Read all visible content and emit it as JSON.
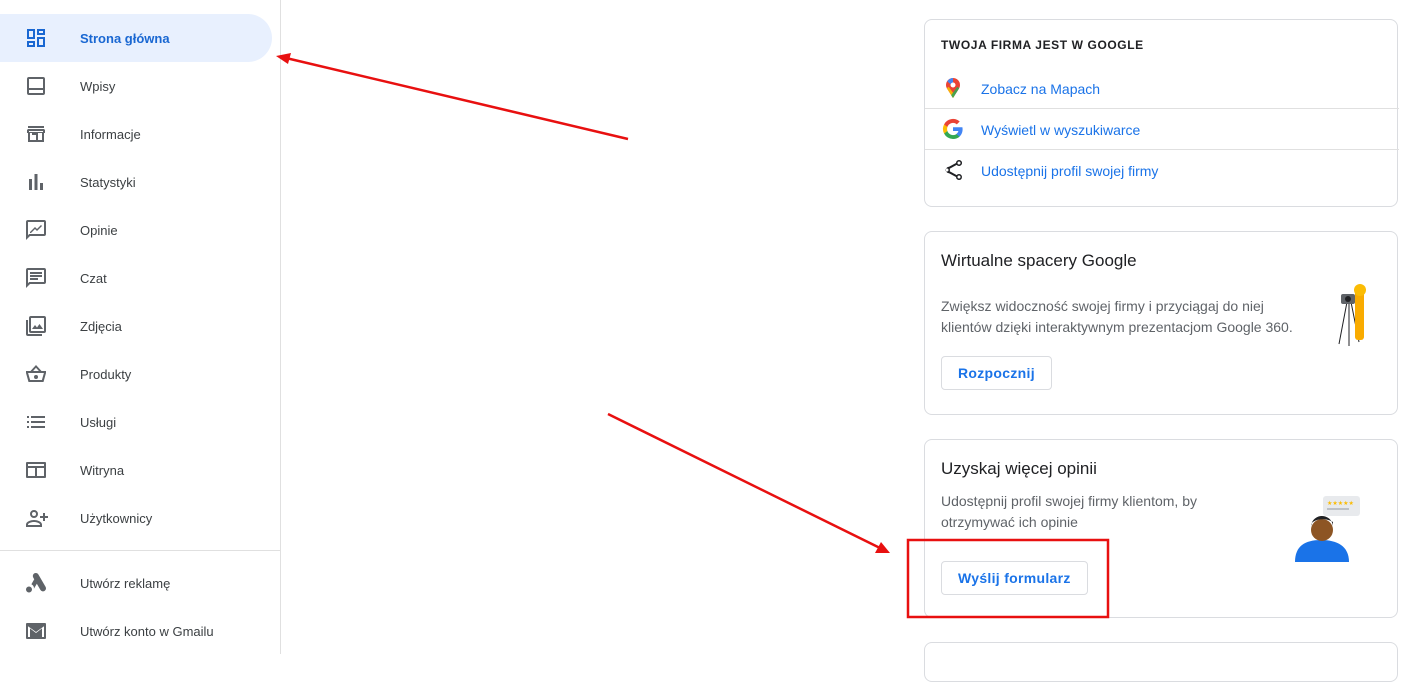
{
  "sidebar": {
    "items": [
      {
        "label": "Strona główna",
        "active": true
      },
      {
        "label": "Wpisy"
      },
      {
        "label": "Informacje"
      },
      {
        "label": "Statystyki"
      },
      {
        "label": "Opinie"
      },
      {
        "label": "Czat"
      },
      {
        "label": "Zdjęcia"
      },
      {
        "label": "Produkty"
      },
      {
        "label": "Usługi"
      },
      {
        "label": "Witryna"
      },
      {
        "label": "Użytkownicy"
      }
    ],
    "extra_items": [
      {
        "label": "Utwórz reklamę"
      },
      {
        "label": "Utwórz konto w Gmailu"
      }
    ],
    "icons": [
      "dashboard-icon",
      "posts-icon",
      "store-icon",
      "bar-chart-icon",
      "reviews-icon",
      "chat-icon",
      "photo-icon",
      "basket-icon",
      "list-icon",
      "website-icon",
      "add-person-icon",
      "google-ads-icon",
      "gmail-icon"
    ]
  },
  "google_card": {
    "header": "TWOJA FIRMA JEST W GOOGLE",
    "links": [
      {
        "label": "Zobacz na Mapach",
        "icon": "google-maps-pin-icon"
      },
      {
        "label": "Wyświetl w wyszukiwarce",
        "icon": "google-g-icon"
      },
      {
        "label": "Udostępnij profil swojej firmy",
        "icon": "share-icon"
      }
    ]
  },
  "tour_card": {
    "title": "Wirtualne spacery Google",
    "desc_line1": "Zwiększ widoczność swojej firmy i przyciągaj do niej",
    "desc_line2": "klientów dzięki interaktywnym prezentacjom Google 360.",
    "button": "Rozpocznij"
  },
  "reviews_card": {
    "title": "Uzyskaj więcej opinii",
    "desc_line1": "Udostępnij profil swojej firmy klientom, by",
    "desc_line2": "otrzymywać ich opinie",
    "button": "Wyślij formularz"
  },
  "colors": {
    "accent": "#1a73e8",
    "active_bg": "#e8f0fe",
    "annotation": "#e81010"
  }
}
